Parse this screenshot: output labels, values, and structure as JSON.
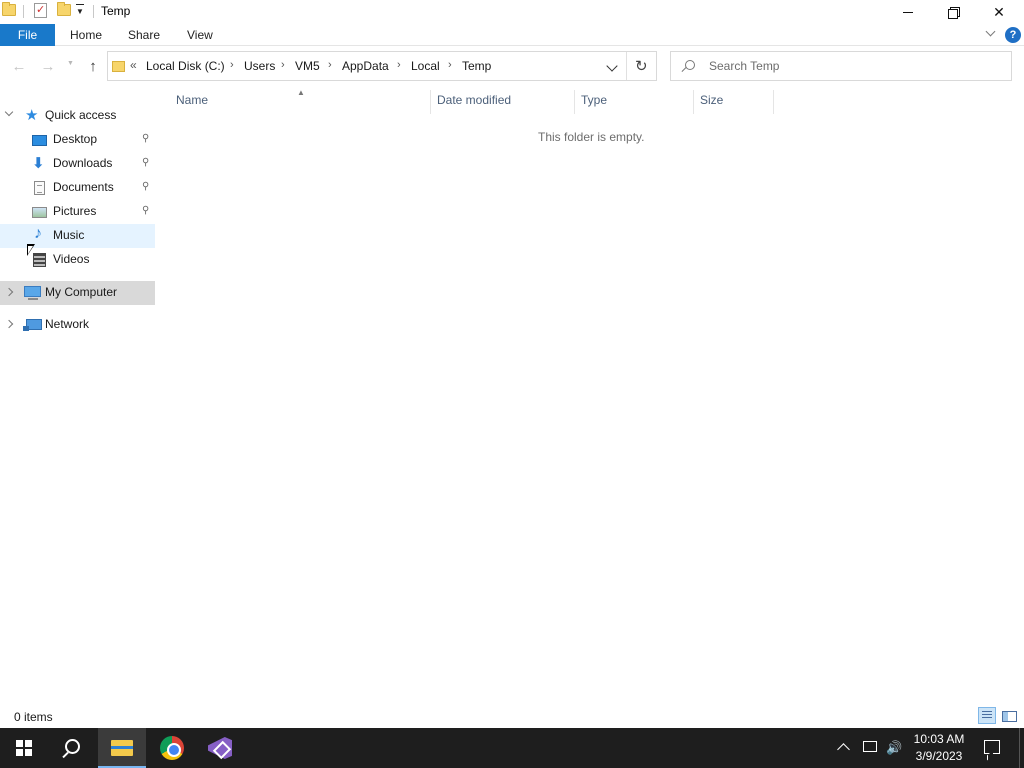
{
  "window": {
    "title": "Temp",
    "controls": {
      "minimize": "minimize",
      "maximize": "restore",
      "close": "close"
    }
  },
  "ribbon": {
    "tabs": [
      {
        "label": "File",
        "active": true
      },
      {
        "label": "Home"
      },
      {
        "label": "Share"
      },
      {
        "label": "View"
      }
    ],
    "help": "?"
  },
  "address": {
    "overflow": "«",
    "breadcrumbs": [
      "Local Disk (C:)",
      "Users",
      "VM5",
      "AppData",
      "Local",
      "Temp"
    ],
    "separator": "›",
    "refresh_icon": "↻"
  },
  "nav_buttons": {
    "back": "←",
    "forward": "→",
    "up": "↑"
  },
  "search": {
    "placeholder": "Search Temp",
    "value": ""
  },
  "navpane": {
    "quick_access": {
      "label": "Quick access",
      "items": [
        {
          "label": "Desktop",
          "pinned": true,
          "icon": "desktop-icon"
        },
        {
          "label": "Downloads",
          "pinned": true,
          "icon": "downloads-icon"
        },
        {
          "label": "Documents",
          "pinned": true,
          "icon": "documents-icon"
        },
        {
          "label": "Pictures",
          "pinned": true,
          "icon": "pictures-icon"
        },
        {
          "label": "Music",
          "pinned": false,
          "icon": "music-icon",
          "state": "hover"
        },
        {
          "label": "Videos",
          "pinned": false,
          "icon": "videos-icon"
        }
      ]
    },
    "my_computer": {
      "label": "My Computer",
      "state": "selected"
    },
    "network": {
      "label": "Network"
    },
    "pin_glyph": "📌"
  },
  "content": {
    "columns": [
      "Name",
      "Date modified",
      "Type",
      "Size"
    ],
    "sort_indicator": "^",
    "empty_message": "This folder is empty."
  },
  "status": {
    "item_count": "0 items"
  },
  "taskbar": {
    "apps": [
      "start-icon",
      "search-icon",
      "file-explorer-icon",
      "chrome-icon",
      "visual-studio-icon"
    ],
    "clock_time": "10:03 AM",
    "clock_date": "3/9/2023",
    "volume_icon": "🔊"
  },
  "colors": {
    "accent": "#1979ca",
    "taskbar": "#1e1e1e",
    "hover": "#e5f3ff",
    "selected": "#d9d9d9"
  }
}
